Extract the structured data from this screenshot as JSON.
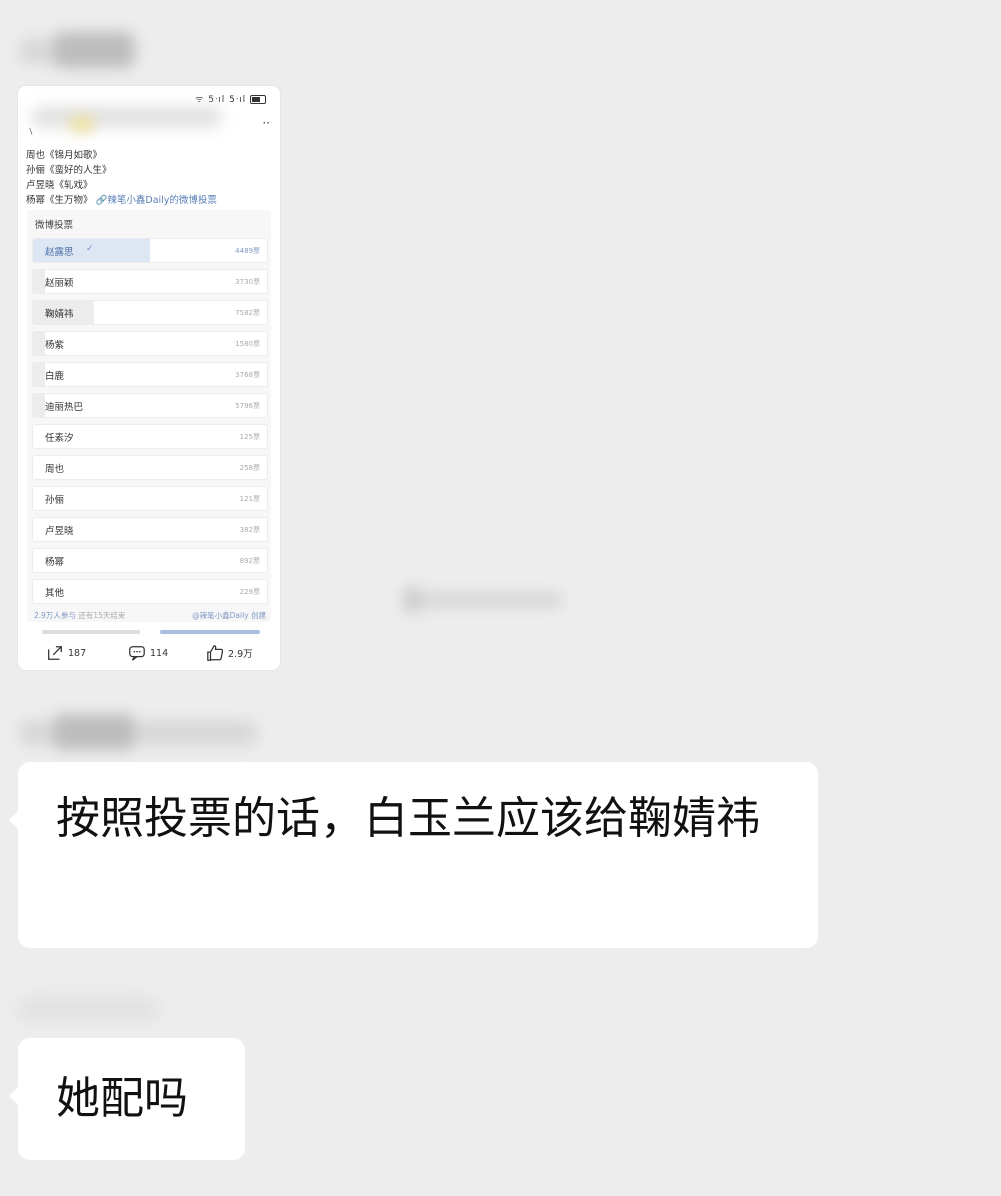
{
  "post": {
    "lines": [
      "周也《锦月如歌》",
      "孙俪《蛮好的人生》",
      "卢昱晓《轧戏》",
      "杨幂《生万物》"
    ],
    "link_text": "辣笔小鑫Daily的微博投票"
  },
  "poll": {
    "title": "微博投票",
    "options": [
      {
        "label": "赵露思",
        "count": "4489票",
        "voted": true,
        "fill": 0.5
      },
      {
        "label": "赵丽颖",
        "count": "3730票",
        "voted": false,
        "fill": 0.05
      },
      {
        "label": "鞠婧祎",
        "count": "7582票",
        "voted": false,
        "fill": 0.26
      },
      {
        "label": "杨紫",
        "count": "1580票",
        "voted": false,
        "fill": 0.05
      },
      {
        "label": "白鹿",
        "count": "3768票",
        "voted": false,
        "fill": 0.05
      },
      {
        "label": "迪丽热巴",
        "count": "5796票",
        "voted": false,
        "fill": 0.05
      },
      {
        "label": "任素汐",
        "count": "125票",
        "voted": false,
        "fill": 0.0
      },
      {
        "label": "周也",
        "count": "258票",
        "voted": false,
        "fill": 0.0
      },
      {
        "label": "孙俪",
        "count": "121票",
        "voted": false,
        "fill": 0.0
      },
      {
        "label": "卢昱晓",
        "count": "382票",
        "voted": false,
        "fill": 0.0
      },
      {
        "label": "杨幂",
        "count": "892票",
        "voted": false,
        "fill": 0.0
      },
      {
        "label": "其他",
        "count": "229票",
        "voted": false,
        "fill": 0.0
      }
    ],
    "participants": "2.9万人参与",
    "remaining": "还有15天结束",
    "creator": "@辣笔小鑫Daily 创建"
  },
  "actions": {
    "share_count": "187",
    "comment_count": "114",
    "like_count": "2.9万"
  },
  "messages": {
    "msg1": "按照投票的话，白玉兰应该给鞠婧祎",
    "msg2": "她配吗"
  },
  "colors": {
    "chat_bg": "#ededed",
    "bubble": "#ffffff",
    "link_blue": "#5b7fb5",
    "voted_fill": "#dde6f3"
  }
}
